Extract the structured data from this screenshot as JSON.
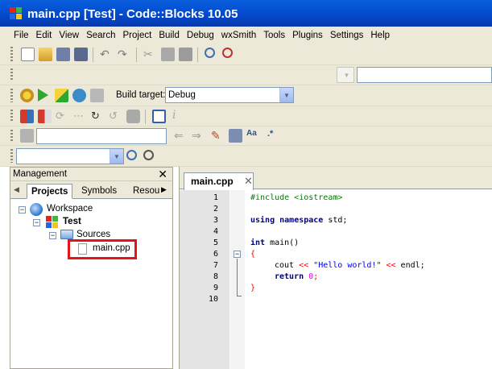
{
  "window": {
    "title": "main.cpp [Test] - Code::Blocks 10.05"
  },
  "menu": [
    "File",
    "Edit",
    "View",
    "Search",
    "Project",
    "Build",
    "Debug",
    "wxSmith",
    "Tools",
    "Plugins",
    "Settings",
    "Help"
  ],
  "compiler_toolbar": {
    "build_target_label": "Build target:",
    "build_target_value": "Debug"
  },
  "management": {
    "title": "Management",
    "tabs": [
      "Projects",
      "Symbols",
      "Resou"
    ],
    "tree": {
      "workspace": "Workspace",
      "project": "Test",
      "folder": "Sources",
      "file": "main.cpp"
    }
  },
  "editor": {
    "tab_label": "main.cpp",
    "line_numbers": [
      "1",
      "2",
      "3",
      "4",
      "5",
      "6",
      "7",
      "8",
      "9",
      "10"
    ],
    "code": {
      "l1": "#include <iostream>",
      "l3_kw1": "using",
      "l3_kw2": "namespace",
      "l3_rest": " std;",
      "l5_kw": "int",
      "l5_rest": " main()",
      "l6": "{",
      "l7_a": "cout ",
      "l7_op1": "<<",
      "l7_str": " \"Hello world!\" ",
      "l7_op2": "<<",
      "l7_b": " endl;",
      "l8_kw": "return",
      "l8_num": " 0",
      "l8_end": ";",
      "l9": "}"
    }
  },
  "colors": {
    "title_bar": "#0454d6",
    "highlight_box": "#e3141b",
    "panel_bg": "#ece9d8"
  }
}
